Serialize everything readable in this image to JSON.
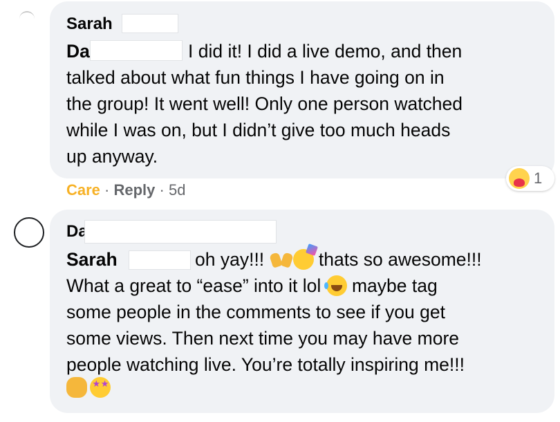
{
  "comment1": {
    "author_first": "Sarah",
    "mention_prefix": "Da",
    "lines": [
      "I did it! I did a live demo, and then",
      "talked about what fun things I have going on in",
      "the group! It went well! Only one person watched",
      "while I was on, but I didn’t give too much heads",
      "up anyway."
    ],
    "reaction_count": "1",
    "reaction_icon": "care-reaction-icon",
    "actions": {
      "reaction_label": "Care",
      "reply_label": "Reply",
      "time": "5d",
      "care_color": "#f7b125"
    }
  },
  "comment2": {
    "author_prefix": "Da",
    "mention_first": "Sarah",
    "line1_a": "oh yay!!!",
    "line1_b": "thats so awesome!!!",
    "line2_a": "What a great to “ease” into it lol",
    "line2_b": "maybe tag",
    "lines": [
      "some people in the comments to see if you get",
      "some views. Then next time you may have more",
      "people watching live. You’re totally inspiring me!!!"
    ],
    "emojis": [
      "raising-hands-icon",
      "partying-face-icon",
      "laughing-icon",
      "clapping-hands-icon",
      "star-struck-icon"
    ]
  },
  "colors": {
    "bubble": "#f0f2f5",
    "text": "#050505",
    "meta": "#65676b"
  }
}
